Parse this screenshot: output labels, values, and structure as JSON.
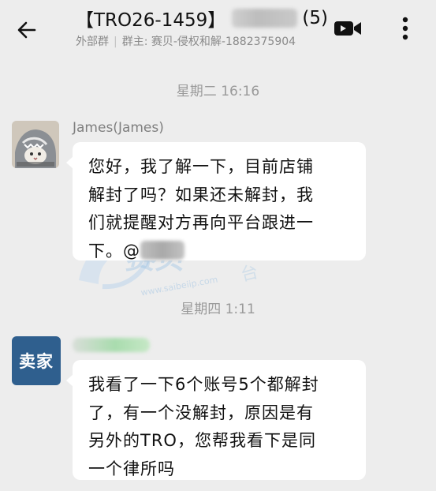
{
  "header": {
    "title_prefix": "【TRO26-1459】",
    "title_suffix": "(5)",
    "subtitle_group_type": "外部群",
    "subtitle_owner": "群主: 赛贝-侵权和解-18823759​04",
    "icons": {
      "back": "back-arrow-icon",
      "video": "video-camera-icon",
      "more": "more-vertical-icon"
    }
  },
  "messages": [
    {
      "time": "星期二 16:16",
      "sender": "James(James)",
      "avatar": "james-avatar-photo",
      "text_before_mention": "您好，我了解一下，目前店铺解封了吗？如果还未解封，我们就提醒对方再向平台跟进一下。@",
      "lines": [
        "您好，我了解一下，目前店铺",
        "解封了吗？如果还未解封，我",
        "们就提醒对方再向平台跟进一",
        "下。@"
      ]
    },
    {
      "time": "星期四 1:11",
      "sender": "",
      "avatar_label": "卖家",
      "lines": [
        "我看了一下6个账号5个都解封",
        "了，有一个没解封，原因是有",
        "另外的TRO，您帮我看下是同",
        "一个律所吗"
      ]
    }
  ],
  "watermark": {
    "brand": "赛贝",
    "tagline": "云知识产权大平台",
    "url": "www.saibeiip.com"
  }
}
